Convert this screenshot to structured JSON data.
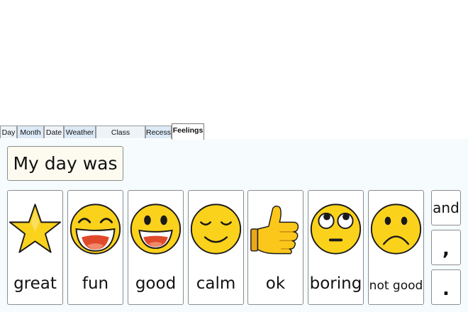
{
  "tabs": [
    {
      "label": "Day"
    },
    {
      "label": "Month"
    },
    {
      "label": "Date"
    },
    {
      "label": "Weather"
    },
    {
      "label": "Class Subjects"
    },
    {
      "label": "Recess"
    },
    {
      "label": "Feelings"
    }
  ],
  "active_tab": "Feelings",
  "sentence": "My day was",
  "cards": [
    {
      "label": "great",
      "icon": "star-icon"
    },
    {
      "label": "fun",
      "icon": "laughing-face-icon"
    },
    {
      "label": "good",
      "icon": "happy-face-icon"
    },
    {
      "label": "calm",
      "icon": "calm-face-icon"
    },
    {
      "label": "ok",
      "icon": "thumbs-up-icon"
    },
    {
      "label": "boring",
      "icon": "eye-roll-face-icon"
    },
    {
      "label": "not good",
      "icon": "sad-face-icon"
    }
  ],
  "connectors": [
    {
      "label": "and"
    },
    {
      "label": ","
    },
    {
      "label": "."
    }
  ],
  "colors": {
    "emoji_yellow": "#fbd21b",
    "outline": "#1a1a1a",
    "mouth_red": "#e04a2b",
    "tab_blue": "#dceaf7",
    "panel_bg": "#f6fbfe",
    "sentence_bg": "#fdfbef"
  }
}
